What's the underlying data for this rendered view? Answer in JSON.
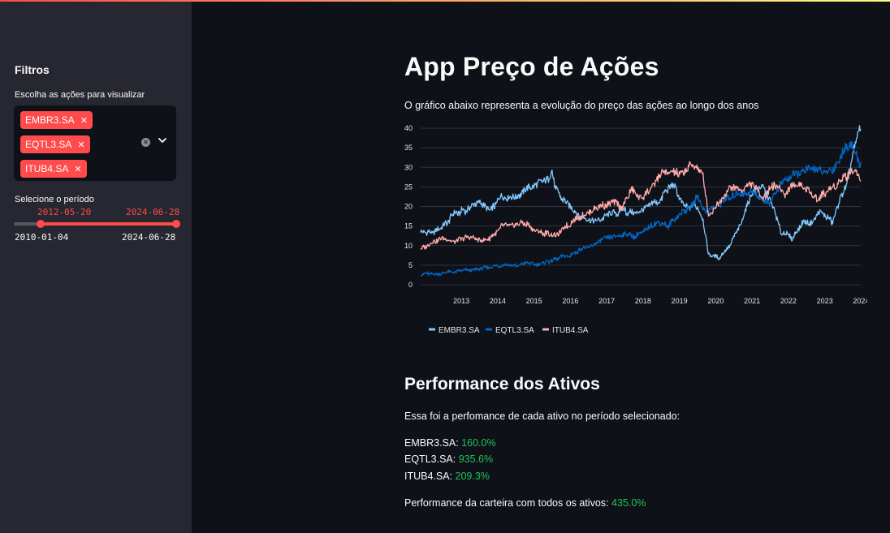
{
  "sidebar": {
    "title": "Filtros",
    "stocks_label": "Escolha as ações para visualizar",
    "selected_stocks": [
      "EMBR3.SA",
      "EQTL3.SA",
      "ITUB4.SA"
    ],
    "period_label": "Selecione o período",
    "slider": {
      "selected_start": "2012-05-20",
      "selected_end": "2024-06-28",
      "min": "2010-01-04",
      "max": "2024-06-28"
    }
  },
  "main": {
    "title": "App Preço de Ações",
    "description": "O gráfico abaixo representa a evolução do preço das ações ao longo dos anos",
    "performance_title": "Performance dos Ativos",
    "performance_intro": "Essa foi a perfomance de cada ativo no período selecionado:",
    "performance": [
      {
        "ticker": "EMBR3.SA",
        "label": "EMBR3.SA:",
        "value": "160.0%"
      },
      {
        "ticker": "EQTL3.SA",
        "label": "EQTL3.SA:",
        "value": "935.6%"
      },
      {
        "ticker": "ITUB4.SA",
        "label": "ITUB4.SA:",
        "value": "209.3%"
      }
    ],
    "portfolio_label": "Performance da carteira com todos os ativos:",
    "portfolio_value": "435.0%"
  },
  "colors": {
    "accent": "#ff4b4b",
    "positive": "#21c354",
    "EMBR3.SA": "#83c9ff",
    "EQTL3.SA": "#0068c9",
    "ITUB4.SA": "#ffabab"
  },
  "chart_data": {
    "type": "line",
    "x_ticks": [
      "2013",
      "2014",
      "2015",
      "2016",
      "2017",
      "2018",
      "2019",
      "2020",
      "2021",
      "2022",
      "2023",
      "2024"
    ],
    "y_ticks": [
      0,
      5,
      10,
      15,
      20,
      25,
      30,
      35,
      40
    ],
    "ylim": [
      0,
      40
    ],
    "xlim": [
      2012.38,
      2024.49
    ],
    "grid": true,
    "legend_position": "bottom",
    "series": [
      {
        "name": "EMBR3.SA",
        "color": "#83c9ff",
        "x": [
          2012.4,
          2012.7,
          2013.0,
          2013.3,
          2013.6,
          2014.0,
          2014.3,
          2014.6,
          2015.0,
          2015.3,
          2015.6,
          2015.9,
          2016.0,
          2016.1,
          2016.4,
          2016.7,
          2017.0,
          2017.3,
          2017.6,
          2018.0,
          2018.3,
          2018.6,
          2019.0,
          2019.3,
          2019.6,
          2020.0,
          2020.15,
          2020.3,
          2020.6,
          2020.9,
          2021.2,
          2021.5,
          2021.8,
          2022.0,
          2022.3,
          2022.6,
          2022.9,
          2023.1,
          2023.4,
          2023.7,
          2023.9,
          2024.1,
          2024.3,
          2024.49
        ],
        "y": [
          14,
          13,
          15,
          18,
          19,
          21,
          18.5,
          23,
          22,
          25,
          26,
          27,
          29,
          24,
          21,
          18,
          17,
          16.5,
          18,
          19,
          18,
          20,
          22,
          26,
          20,
          20,
          17,
          8,
          7,
          10,
          16,
          23,
          25,
          22,
          13.5,
          12,
          16,
          15.5,
          19,
          16,
          21,
          25,
          35,
          40
        ]
      },
      {
        "name": "EQTL3.SA",
        "color": "#0068c9",
        "x": [
          2012.4,
          2012.7,
          2013.0,
          2013.3,
          2013.6,
          2014.0,
          2014.3,
          2014.6,
          2015.0,
          2015.3,
          2015.6,
          2015.9,
          2016.2,
          2016.5,
          2016.8,
          2017.1,
          2017.4,
          2017.7,
          2018.0,
          2018.3,
          2018.6,
          2018.9,
          2019.2,
          2019.5,
          2019.8,
          2020.0,
          2020.2,
          2020.5,
          2020.8,
          2021.1,
          2021.4,
          2021.7,
          2022.0,
          2022.3,
          2022.6,
          2022.9,
          2023.2,
          2023.5,
          2023.8,
          2024.0,
          2024.2,
          2024.49
        ],
        "y": [
          2.6,
          2.9,
          3.0,
          3.3,
          3.8,
          4.0,
          4.3,
          5.0,
          4.8,
          5.4,
          5.2,
          6.0,
          7.0,
          7.5,
          9.0,
          10.0,
          11.5,
          12.0,
          13.0,
          12.5,
          14.0,
          16.0,
          15.0,
          18.0,
          20.0,
          23.0,
          19.0,
          20.0,
          22.0,
          23.0,
          24.0,
          22.0,
          21.0,
          26.0,
          28.0,
          29.0,
          30.0,
          28.0,
          30.0,
          34.0,
          36.0,
          31.0
        ]
      },
      {
        "name": "ITUB4.SA",
        "color": "#ffabab",
        "x": [
          2012.4,
          2012.7,
          2013.0,
          2013.3,
          2013.6,
          2014.0,
          2014.3,
          2014.6,
          2014.9,
          2015.2,
          2015.5,
          2015.8,
          2016.1,
          2016.4,
          2016.7,
          2017.0,
          2017.3,
          2017.6,
          2017.9,
          2018.2,
          2018.5,
          2018.8,
          2019.1,
          2019.4,
          2019.7,
          2019.95,
          2020.15,
          2020.3,
          2020.6,
          2020.9,
          2021.2,
          2021.5,
          2021.8,
          2022.1,
          2022.4,
          2022.7,
          2023.0,
          2023.3,
          2023.6,
          2023.9,
          2024.1,
          2024.3,
          2024.49
        ],
        "y": [
          9.0,
          11.0,
          12.0,
          11.0,
          12.0,
          11.5,
          12.0,
          15.0,
          15.0,
          16.0,
          14.0,
          13.0,
          12.5,
          15.0,
          17.0,
          18.0,
          20.0,
          21.0,
          20.0,
          24.0,
          22.0,
          26.0,
          29.0,
          28.0,
          30.0,
          30.0,
          28.0,
          18.0,
          21.0,
          25.0,
          24.0,
          26.0,
          22.0,
          26.0,
          23.0,
          26.0,
          24.0,
          22.0,
          24.0,
          26.0,
          28.0,
          30.0,
          27.0
        ]
      }
    ]
  }
}
